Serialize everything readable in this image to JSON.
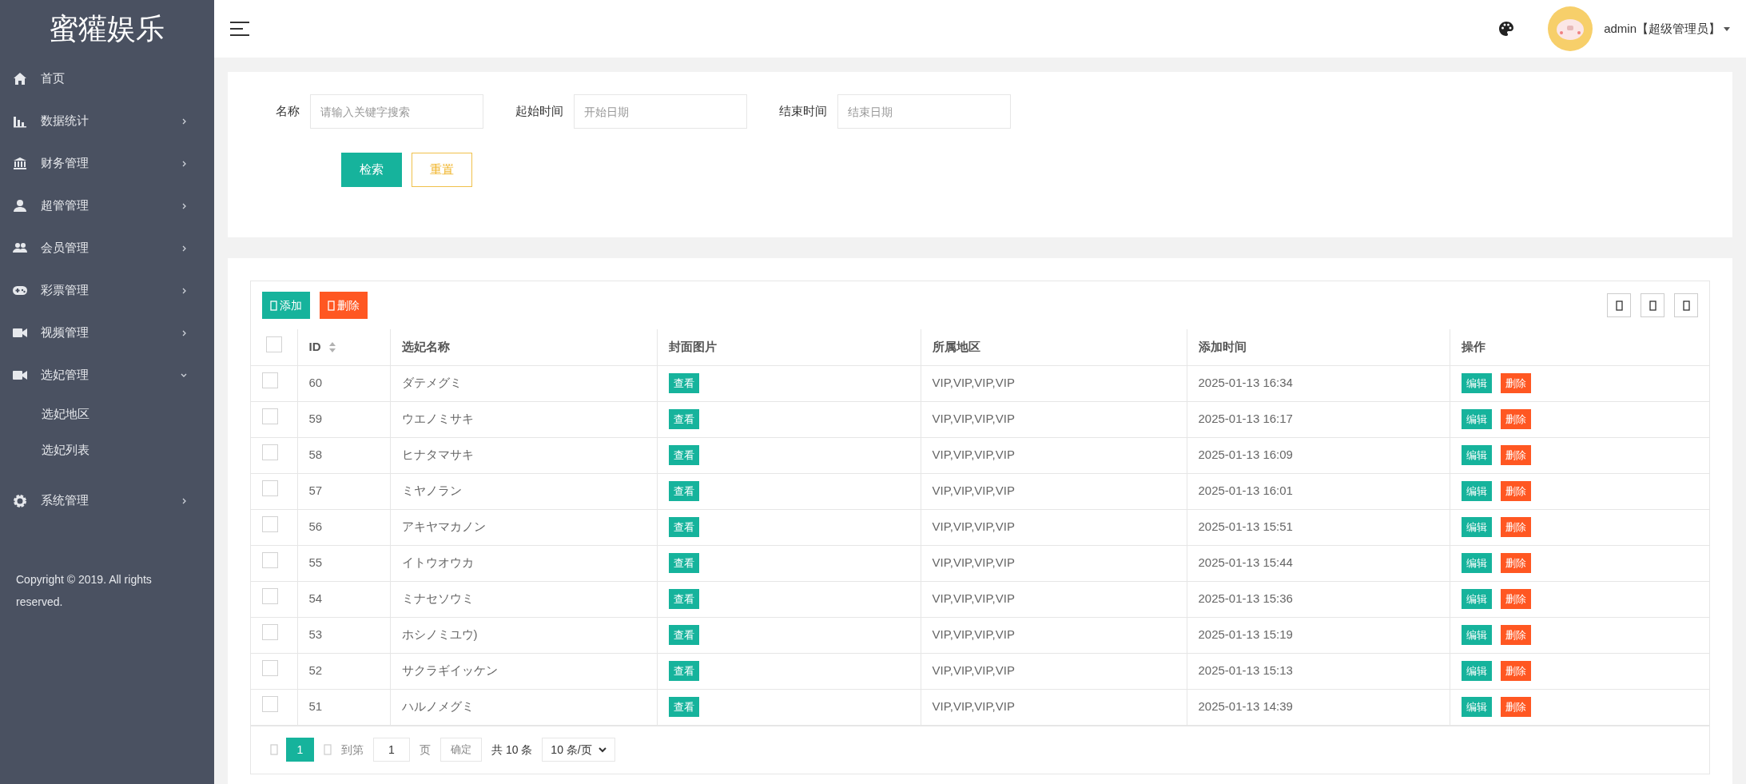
{
  "sidebar": {
    "logo": "蜜獾娱乐",
    "items": [
      {
        "label": "首页"
      },
      {
        "label": "数据统计",
        "expanded": false
      },
      {
        "label": "财务管理",
        "expanded": false
      },
      {
        "label": "超管管理",
        "expanded": false
      },
      {
        "label": "会员管理",
        "expanded": false
      },
      {
        "label": "彩票管理",
        "expanded": false
      },
      {
        "label": "视频管理",
        "expanded": false
      },
      {
        "label": "选妃管理",
        "expanded": true,
        "children": [
          {
            "label": "选妃地区"
          },
          {
            "label": "选妃列表"
          }
        ]
      },
      {
        "label": "系统管理",
        "expanded": false
      }
    ],
    "copyright": "Copyright © 2019. All rights reserved."
  },
  "header": {
    "user": "admin【超级管理员】"
  },
  "search_form": {
    "fields": [
      {
        "label": "名称",
        "placeholder": "请输入关键字搜索"
      },
      {
        "label": "起始时间",
        "placeholder": "开始日期"
      },
      {
        "label": "结束时间",
        "placeholder": "结束日期"
      }
    ],
    "buttons": [
      "检索",
      "重置"
    ]
  },
  "toolbar": {
    "buttons": [
      "添加",
      "删除"
    ]
  },
  "table": {
    "columns": [
      "ID",
      "选妃名称",
      "封面图片",
      "所属地区",
      "添加时间",
      "操作"
    ],
    "header_checked": false,
    "rows": [
      {
        "id": "60",
        "name": "ダテメグミ",
        "cover": "查看",
        "region": "VIP,VIP,VIP,VIP",
        "time": "2025-01-13 16:34",
        "actions": [
          "编辑",
          "删除"
        ],
        "checked": false
      },
      {
        "id": "59",
        "name": "ウエノミサキ",
        "cover": "查看",
        "region": "VIP,VIP,VIP,VIP",
        "time": "2025-01-13 16:17",
        "actions": [
          "编辑",
          "删除"
        ],
        "checked": false
      },
      {
        "id": "58",
        "name": "ヒナタマサキ",
        "cover": "查看",
        "region": "VIP,VIP,VIP,VIP",
        "time": "2025-01-13 16:09",
        "actions": [
          "编辑",
          "删除"
        ],
        "checked": false
      },
      {
        "id": "57",
        "name": "ミヤノラン",
        "cover": "查看",
        "region": "VIP,VIP,VIP,VIP",
        "time": "2025-01-13 16:01",
        "actions": [
          "编辑",
          "删除"
        ],
        "checked": false
      },
      {
        "id": "56",
        "name": "アキヤマカノン",
        "cover": "查看",
        "region": "VIP,VIP,VIP,VIP",
        "time": "2025-01-13 15:51",
        "actions": [
          "编辑",
          "删除"
        ],
        "checked": false
      },
      {
        "id": "55",
        "name": "イトウオウカ",
        "cover": "查看",
        "region": "VIP,VIP,VIP,VIP",
        "time": "2025-01-13 15:44",
        "actions": [
          "编辑",
          "删除"
        ],
        "checked": false
      },
      {
        "id": "54",
        "name": "ミナセソウミ",
        "cover": "查看",
        "region": "VIP,VIP,VIP,VIP",
        "time": "2025-01-13 15:36",
        "actions": [
          "编辑",
          "删除"
        ],
        "checked": false
      },
      {
        "id": "53",
        "name": "ホシノミユウ)",
        "cover": "查看",
        "region": "VIP,VIP,VIP,VIP",
        "time": "2025-01-13 15:19",
        "actions": [
          "编辑",
          "删除"
        ],
        "checked": false
      },
      {
        "id": "52",
        "name": "サクラギイッケン",
        "cover": "查看",
        "region": "VIP,VIP,VIP,VIP",
        "time": "2025-01-13 15:13",
        "actions": [
          "编辑",
          "删除"
        ],
        "checked": false
      },
      {
        "id": "51",
        "name": "ハルノメグミ",
        "cover": "查看",
        "region": "VIP,VIP,VIP,VIP",
        "time": "2025-01-13 14:39",
        "actions": [
          "编辑",
          "删除"
        ],
        "checked": false
      }
    ]
  },
  "pagination": {
    "pages": [
      {
        "label": "1",
        "selected": true
      }
    ],
    "goto_label": "到第",
    "goto_value": "1",
    "page_unit": "页",
    "confirm": "确定",
    "total": "共 10 条",
    "page_size": "10 条/页"
  }
}
